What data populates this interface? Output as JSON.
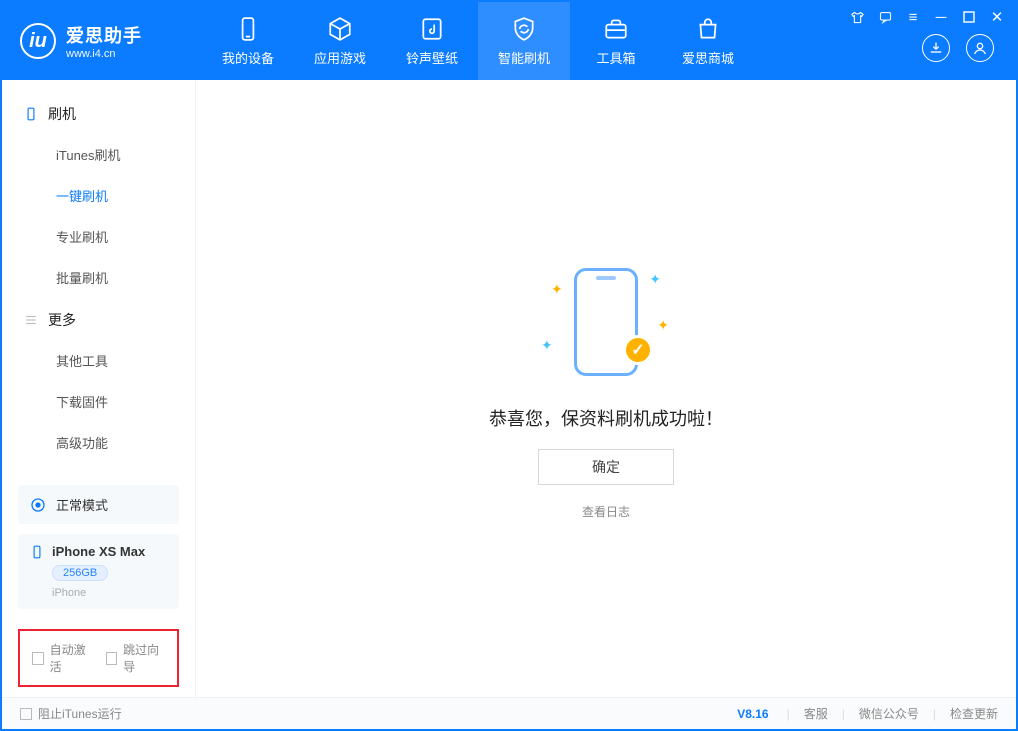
{
  "brand": {
    "name": "爱思助手",
    "url": "www.i4.cn"
  },
  "nav": {
    "tabs": [
      {
        "label": "我的设备"
      },
      {
        "label": "应用游戏"
      },
      {
        "label": "铃声壁纸"
      },
      {
        "label": "智能刷机"
      },
      {
        "label": "工具箱"
      },
      {
        "label": "爱思商城"
      }
    ]
  },
  "sidebar": {
    "section1_title": "刷机",
    "items1": [
      {
        "label": "iTunes刷机"
      },
      {
        "label": "一键刷机"
      },
      {
        "label": "专业刷机"
      },
      {
        "label": "批量刷机"
      }
    ],
    "section2_title": "更多",
    "items2": [
      {
        "label": "其他工具"
      },
      {
        "label": "下载固件"
      },
      {
        "label": "高级功能"
      }
    ],
    "mode_label": "正常模式",
    "device_name": "iPhone XS Max",
    "device_storage": "256GB",
    "device_type": "iPhone",
    "opt_auto_activate": "自动激活",
    "opt_skip_guide": "跳过向导"
  },
  "main": {
    "success_text": "恭喜您，保资料刷机成功啦！",
    "ok_label": "确定",
    "log_link": "查看日志"
  },
  "footer": {
    "block_itunes": "阻止iTunes运行",
    "version": "V8.16",
    "link_cs": "客服",
    "link_wechat": "微信公众号",
    "link_update": "检查更新"
  }
}
